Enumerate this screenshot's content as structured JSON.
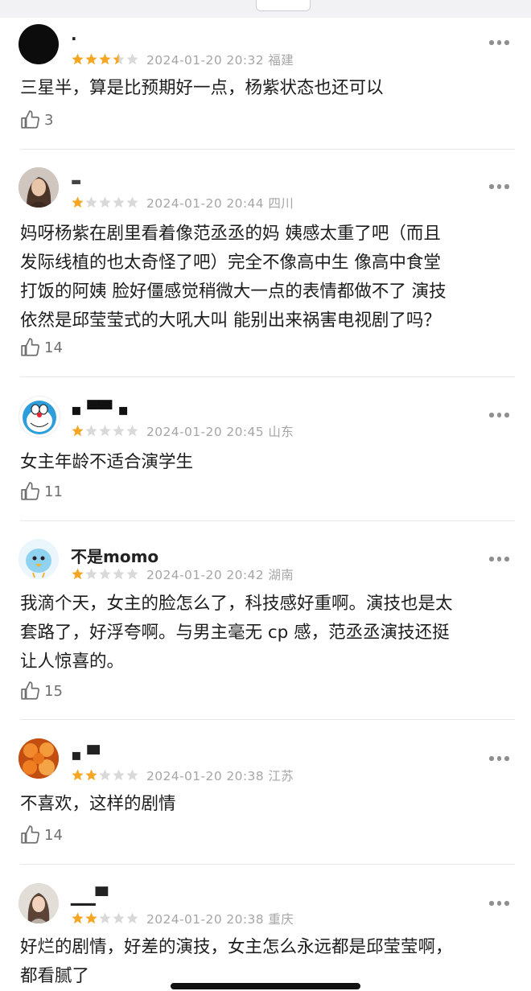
{
  "colors": {
    "star_filled": "#f5a623",
    "star_empty": "#d9d9d9",
    "meta": "#a6a6a6",
    "text": "#1d1d1d"
  },
  "comments": [
    {
      "user": "·",
      "rating": 3.5,
      "stars": 3,
      "half": true,
      "time": "2024-01-20 20:32",
      "location": "福建",
      "text": [
        "三星半，算是比预期好一点，杨紫状态也还可以"
      ],
      "likes": "3",
      "avatar_icon": "black-circle-avatar"
    },
    {
      "user": "▬",
      "rating": 1,
      "stars": 1,
      "half": false,
      "time": "2024-01-20 20:44",
      "location": "四川",
      "text": [
        "妈呀杨紫在剧里看着像范丞丞的妈 姨感太重了吧（而且",
        "发际线植的也太奇怪了吧）完全不像高中生 像高中食堂",
        "打饭的阿姨 脸好僵感觉稍微大一点的表情都做不了 演技",
        "依然是邱莹莹式的大吼大叫 能别出来祸害电视剧了吗？"
      ],
      "likes": "14",
      "avatar_icon": "woman-portrait-avatar"
    },
    {
      "user": "▪ ▀▀ ▪",
      "rating": 1,
      "stars": 1,
      "half": false,
      "time": "2024-01-20 20:45",
      "location": "山东",
      "text": [
        "女主年龄不适合演学生"
      ],
      "likes": "11",
      "avatar_icon": "doraemon-avatar"
    },
    {
      "user": "不是momo",
      "rating": 1,
      "stars": 1,
      "half": false,
      "time": "2024-01-20 20:42",
      "location": "湖南",
      "text": [
        "我滴个天，女主的脸怎么了，科技感好重啊。演技也是太",
        "套路了，好浮夸啊。与男主毫无 cp 感，范丞丞演技还挺",
        "让人惊喜的。"
      ],
      "likes": "15",
      "avatar_icon": "cartoon-bird-avatar"
    },
    {
      "user": "▪ ▀",
      "rating": 2,
      "stars": 2,
      "half": false,
      "time": "2024-01-20 20:38",
      "location": "江苏",
      "text": [
        "不喜欢，这样的剧情"
      ],
      "likes": "14",
      "avatar_icon": "orange-flowers-avatar"
    },
    {
      "user": "▁▁▀",
      "rating": 2,
      "stars": 2,
      "half": false,
      "time": "2024-01-20 20:38",
      "location": "重庆",
      "text": [
        "好烂的剧情，好差的演技，女主怎么永远都是邱莹莹啊，",
        "都看腻了"
      ],
      "likes": "",
      "avatar_icon": "girl-photo-avatar"
    }
  ]
}
